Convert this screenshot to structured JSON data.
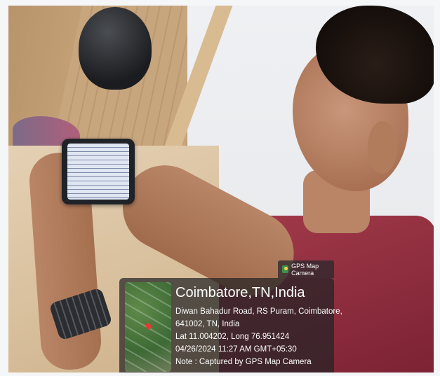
{
  "overlay": {
    "app_tag": "GPS Map Camera",
    "app_icon": "gps-map-camera-icon",
    "location_title": "Coimbatore,TN,India",
    "address_line1": "Diwan Bahadur Road, RS Puram, Coimbatore,",
    "address_line2": "641002, TN, India",
    "coordinates": "Lat 11.004202, Long 76.951424",
    "timestamp": "04/26/2024 11:27 AM GMT+05:30",
    "note": "Note : Captured by GPS Map Camera"
  },
  "scene": {
    "colors": {
      "shirt": "#8f2e3e",
      "wood": "#c9a67c",
      "wall": "#eef0f3"
    }
  }
}
